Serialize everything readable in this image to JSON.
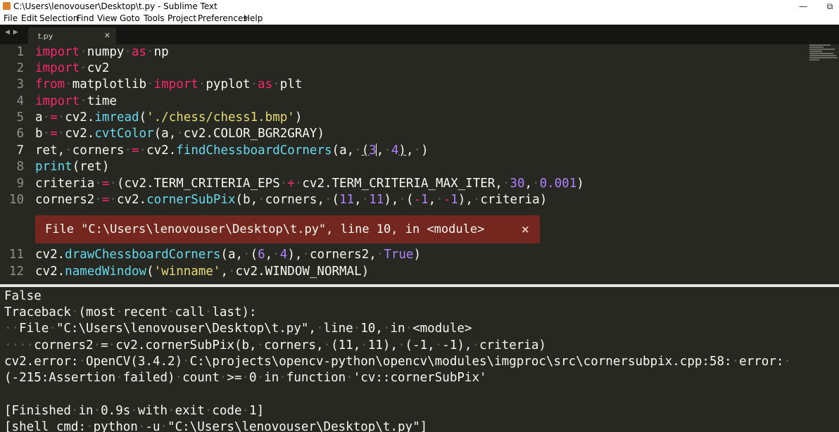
{
  "window": {
    "title": "C:\\Users\\lenovouser\\Desktop\\t.py - Sublime Text",
    "restore_glyph": "⧉",
    "minimize_glyph": "—"
  },
  "menu": [
    "File",
    "Edit",
    "Selection",
    "Find",
    "View",
    "Goto",
    "Tools",
    "Project",
    "Preferences",
    "Help"
  ],
  "tabbar": {
    "nav_arrows": "◀ ▶",
    "tab_label": "t.py",
    "tab_close": "✕"
  },
  "editor": {
    "lines": [
      {
        "num": "1",
        "code": "import numpy as np"
      },
      {
        "num": "2",
        "code": "import cv2"
      },
      {
        "num": "3",
        "code": "from matplotlib import pyplot as plt"
      },
      {
        "num": "4",
        "code": "import time"
      },
      {
        "num": "5",
        "code": "a = cv2.imread('./chess/chess1.bmp')"
      },
      {
        "num": "6",
        "code": "b = cv2.cvtColor(a, cv2.COLOR_BGR2GRAY)"
      },
      {
        "num": "7",
        "code": "ret, corners = cv2.findChessboardCorners(a, (3, 4), )"
      },
      {
        "num": "8",
        "code": "print(ret)"
      },
      {
        "num": "9",
        "code": "criteria = (cv2.TERM_CRITERIA_EPS + cv2.TERM_CRITERIA_MAX_ITER, 30, 0.001)"
      },
      {
        "num": "10",
        "code": "corners2 = cv2.cornerSubPix(b, corners, (11, 11), (-1, -1), criteria)"
      },
      {
        "num": "11",
        "code": "cv2.drawChessboardCorners(a, (6, 4), corners2, True)"
      },
      {
        "num": "12",
        "code": "cv2.namedWindow('winname', cv2.WINDOW_NORMAL)"
      }
    ],
    "error_popup": {
      "text": "File \"C:\\Users\\lenovouser\\Desktop\\t.py\", line 10, in <module>",
      "close": "×"
    }
  },
  "console": {
    "lines": [
      "False",
      "Traceback (most recent call last):",
      "  File \"C:\\Users\\lenovouser\\Desktop\\t.py\", line 10, in <module>",
      "    corners2 = cv2.cornerSubPix(b, corners, (11, 11), (-1, -1), criteria)",
      "cv2.error: OpenCV(3.4.2) C:\\projects\\opencv-python\\opencv\\modules\\imgproc\\src\\cornersubpix.cpp:58: error: ",
      "(-215:Assertion failed) count >= 0 in function 'cv::cornerSubPix'",
      "",
      "[Finished in 0.9s with exit code 1]",
      "[shell_cmd: python -u \"C:\\Users\\lenovouser\\Desktop\\t.py\"]"
    ]
  },
  "colors": {
    "background": "#272822",
    "keyword": "#f92672",
    "function": "#66d9ef",
    "string": "#e6db74",
    "number": "#ae81ff",
    "error_bg": "#74271e"
  }
}
